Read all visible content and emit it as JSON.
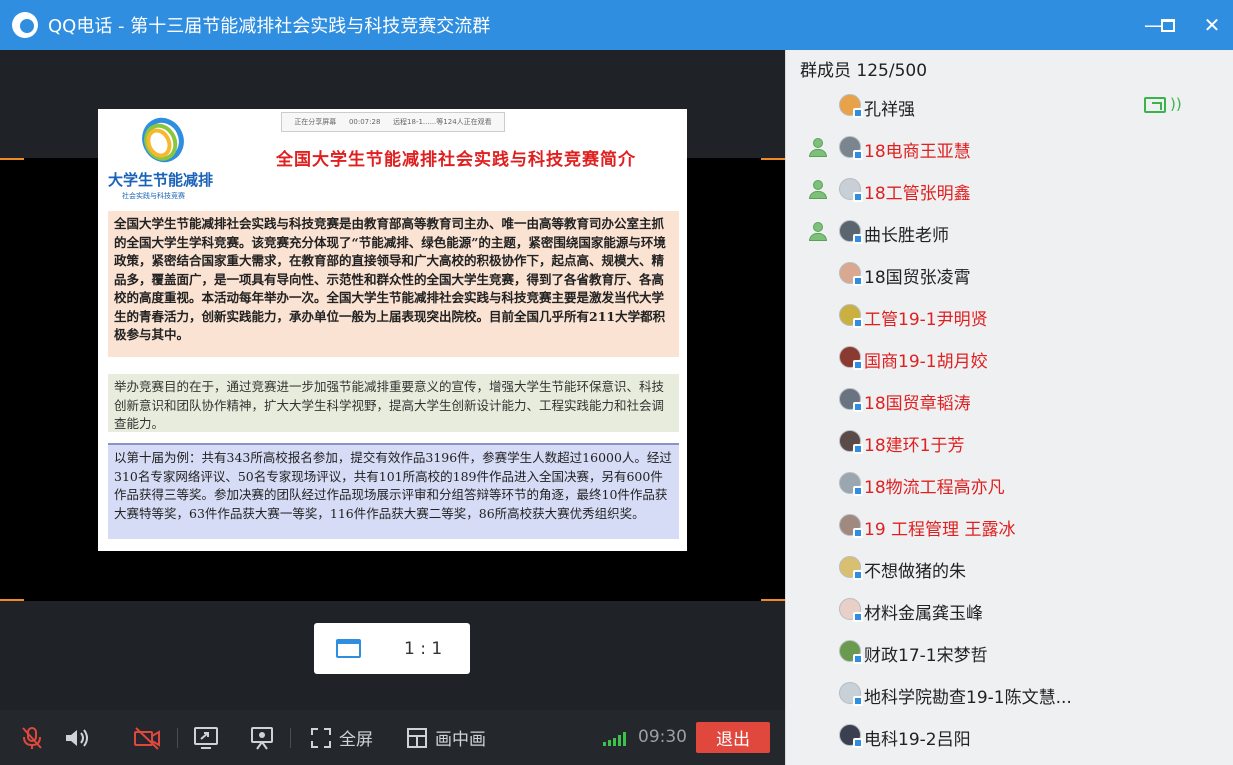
{
  "window": {
    "title": "QQ电话 - 第十三届节能减排社会实践与科技竞赛交流群",
    "minimize_label": "—",
    "maximize_label": "☐",
    "close_label": "✕"
  },
  "slide": {
    "toolbar_items": [
      "正在分享屏幕",
      "00:07:28",
      "远程18-1......等124人正在观看"
    ],
    "brand": "大学生节能减排",
    "brand_sub": "社会实践与科技竞赛",
    "title": "全国大学生节能减排社会实践与科技竞赛简介",
    "para1": "全国大学生节能减排社会实践与科技竞赛是由教育部高等教育司主办、唯一由高等教育司办公室主抓的全国大学生学科竞赛。该竞赛充分体现了“节能减排、绿色能源”的主题，紧密围绕国家能源与环境政策，紧密结合国家重大需求，在教育部的直接领导和广大高校的积极协作下，起点高、规模大、精品多，覆盖面广，是一项具有导向性、示范性和群众性的全国大学生竞赛，得到了各省教育厅、各高校的高度重视。本活动每年举办一次。全国大学生节能减排社会实践与科技竞赛主要是激发当代大学生的青春活力，创新实践能力，承办单位一般为上届表现突出院校。目前全国几乎所有211大学都积极参与其中。",
    "para2": "举办竞赛目的在于，通过竞赛进一步加强节能减排重要意义的宣传，增强大学生节能环保意识、科技创新意识和团队协作精神，扩大大学生科学视野，提高大学生创新设计能力、工程实践能力和社会调查能力。",
    "para3": "以第十届为例：共有343所高校报名参加，提交有效作品3196件，参赛学生人数超过16000人。经过310名专家网络评议、50名专家现场评议，共有101所高校的189件作品进入全国决赛，另有600件作品获得三等奖。参加决赛的团队经过作品现场展示评审和分组答辩等环节的角逐，最终10件作品获大赛特等奖，63件作品获大赛一等奖，116件作品获大赛二等奖，86所高校获大赛优秀组织奖。"
  },
  "ratio": {
    "label": "1 : 1"
  },
  "toolbar": {
    "fullscreen_label": "全屏",
    "pip_label": "画中画",
    "timer": "09:30",
    "exit_label": "退出"
  },
  "members": {
    "header": "群成员 125/500",
    "list": [
      {
        "name": "孔祥强",
        "color": "#222222",
        "role": false,
        "sharing": true,
        "avatar_color": "#e8a24a"
      },
      {
        "name": "18电商王亚慧",
        "color": "#e02020",
        "role": true,
        "sharing": false,
        "avatar_color": "#7a8590"
      },
      {
        "name": "18工管张明鑫",
        "color": "#e02020",
        "role": true,
        "sharing": false,
        "avatar_color": "#c9cfd6"
      },
      {
        "name": "曲长胜老师",
        "color": "#222222",
        "role": true,
        "sharing": false,
        "avatar_color": "#5a6570"
      },
      {
        "name": "18国贸张凌霄",
        "color": "#222222",
        "role": false,
        "sharing": false,
        "avatar_color": "#d8a890"
      },
      {
        "name": "工管19-1尹明贤",
        "color": "#e02020",
        "role": false,
        "sharing": false,
        "avatar_color": "#c9b040"
      },
      {
        "name": "国商19-1胡月姣",
        "color": "#e02020",
        "role": false,
        "sharing": false,
        "avatar_color": "#8a3a30"
      },
      {
        "name": "18国贸章韬涛",
        "color": "#e02020",
        "role": false,
        "sharing": false,
        "avatar_color": "#6a7480"
      },
      {
        "name": "18建环1于芳",
        "color": "#e02020",
        "role": false,
        "sharing": false,
        "avatar_color": "#5a4a48"
      },
      {
        "name": "18物流工程高亦凡",
        "color": "#e02020",
        "role": false,
        "sharing": false,
        "avatar_color": "#9aa6b0"
      },
      {
        "name": "19 工程管理 王露冰",
        "color": "#e02020",
        "role": false,
        "sharing": false,
        "avatar_color": "#a08a80"
      },
      {
        "name": "不想做猪的朱",
        "color": "#222222",
        "role": false,
        "sharing": false,
        "avatar_color": "#d8c070"
      },
      {
        "name": "材料金属龚玉峰",
        "color": "#222222",
        "role": false,
        "sharing": false,
        "avatar_color": "#e8d0c8"
      },
      {
        "name": "财政17-1宋梦哲",
        "color": "#222222",
        "role": false,
        "sharing": false,
        "avatar_color": "#6a9a50"
      },
      {
        "name": "地科学院勘查19-1陈文慧...",
        "color": "#222222",
        "role": false,
        "sharing": false,
        "avatar_color": "#c8d0d8"
      },
      {
        "name": "电科19-2吕阳",
        "color": "#222222",
        "role": false,
        "sharing": false,
        "avatar_color": "#3a4050"
      }
    ]
  }
}
